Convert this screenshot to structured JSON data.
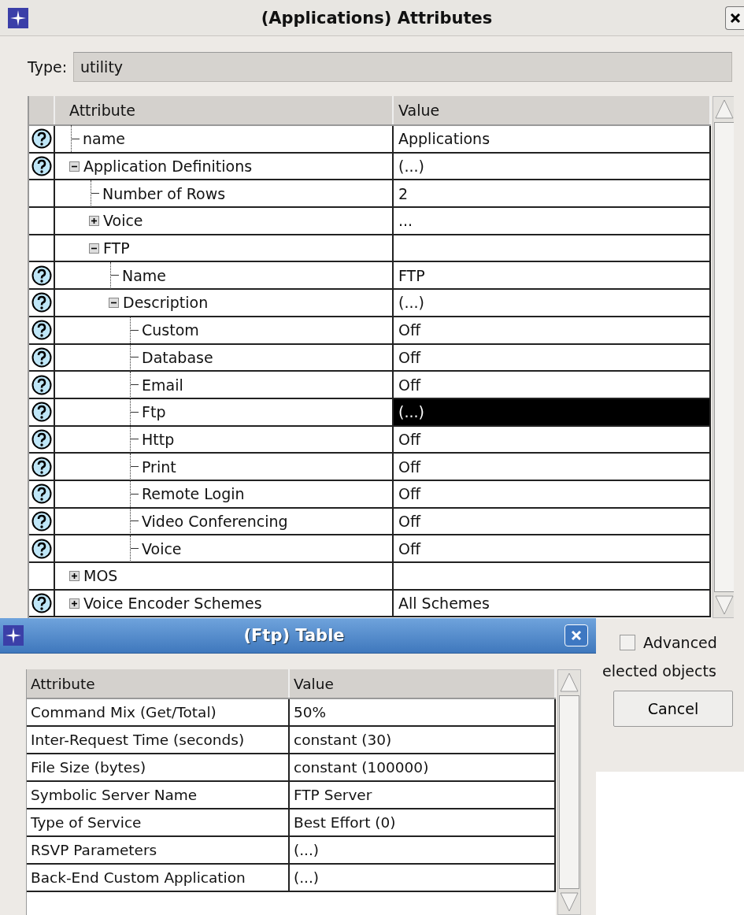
{
  "window": {
    "title": "(Applications) Attributes"
  },
  "type_field": {
    "label": "Type:",
    "value": "utility"
  },
  "attributes_table": {
    "columns": [
      "Attribute",
      "Value"
    ],
    "rows": [
      {
        "attribute": "name",
        "value": "Applications",
        "help": true,
        "kind": "leaf",
        "selected": false
      },
      {
        "attribute": "Application Definitions",
        "value": "(...)",
        "help": true,
        "kind": "group",
        "expanded": true,
        "selected": false,
        "children": [
          {
            "attribute": "Number of Rows",
            "value": "2",
            "help": false,
            "kind": "leaf",
            "selected": false
          },
          {
            "attribute": "Voice",
            "value": "...",
            "help": false,
            "kind": "group",
            "expanded": false,
            "selected": false
          },
          {
            "attribute": "FTP",
            "help": false,
            "kind": "group",
            "expanded": true,
            "selected": false,
            "children": [
              {
                "attribute": "Name",
                "value": "FTP",
                "help": true,
                "kind": "leaf",
                "selected": false
              },
              {
                "attribute": "Description",
                "value": "(...)",
                "help": true,
                "kind": "group",
                "expanded": true,
                "selected": false,
                "children": [
                  {
                    "attribute": "Custom",
                    "value": "Off",
                    "help": true,
                    "kind": "leaf",
                    "selected": false
                  },
                  {
                    "attribute": "Database",
                    "value": "Off",
                    "help": true,
                    "kind": "leaf",
                    "selected": false
                  },
                  {
                    "attribute": "Email",
                    "value": "Off",
                    "help": true,
                    "kind": "leaf",
                    "selected": false
                  },
                  {
                    "attribute": "Ftp",
                    "value": "(...)",
                    "help": true,
                    "kind": "leaf",
                    "selected": true
                  },
                  {
                    "attribute": "Http",
                    "value": "Off",
                    "help": true,
                    "kind": "leaf",
                    "selected": false
                  },
                  {
                    "attribute": "Print",
                    "value": "Off",
                    "help": true,
                    "kind": "leaf",
                    "selected": false
                  },
                  {
                    "attribute": "Remote Login",
                    "value": "Off",
                    "help": true,
                    "kind": "leaf",
                    "selected": false
                  },
                  {
                    "attribute": "Video Conferencing",
                    "value": "Off",
                    "help": true,
                    "kind": "leaf",
                    "selected": false
                  },
                  {
                    "attribute": "Voice",
                    "value": "Off",
                    "help": true,
                    "kind": "leaf",
                    "selected": false
                  }
                ]
              }
            ]
          }
        ]
      },
      {
        "attribute": "MOS",
        "help": false,
        "kind": "group",
        "expanded": false,
        "selected": false
      },
      {
        "attribute": "Voice Encoder Schemes",
        "value": "All Schemes",
        "help": true,
        "kind": "group",
        "expanded": false,
        "selected": false
      }
    ]
  },
  "advanced_checkbox": {
    "label": "Advanced",
    "checked": false
  },
  "hint_text": "elected objects",
  "cancel_button": "Cancel",
  "ftp_dialog": {
    "title": "(Ftp) Table",
    "table": {
      "columns": [
        "Attribute",
        "Value"
      ],
      "rows": [
        {
          "attribute": "Command Mix (Get/Total)",
          "value": "50%"
        },
        {
          "attribute": "Inter-Request Time (seconds)",
          "value": "constant (30)"
        },
        {
          "attribute": "File Size (bytes)",
          "value": "constant (100000)"
        },
        {
          "attribute": "Symbolic Server Name",
          "value": "FTP Server"
        },
        {
          "attribute": "Type of Service",
          "value": "Best Effort (0)"
        },
        {
          "attribute": "RSVP Parameters",
          "value": "(...)"
        },
        {
          "attribute": "Back-End Custom Application",
          "value": "(...)"
        }
      ]
    }
  }
}
